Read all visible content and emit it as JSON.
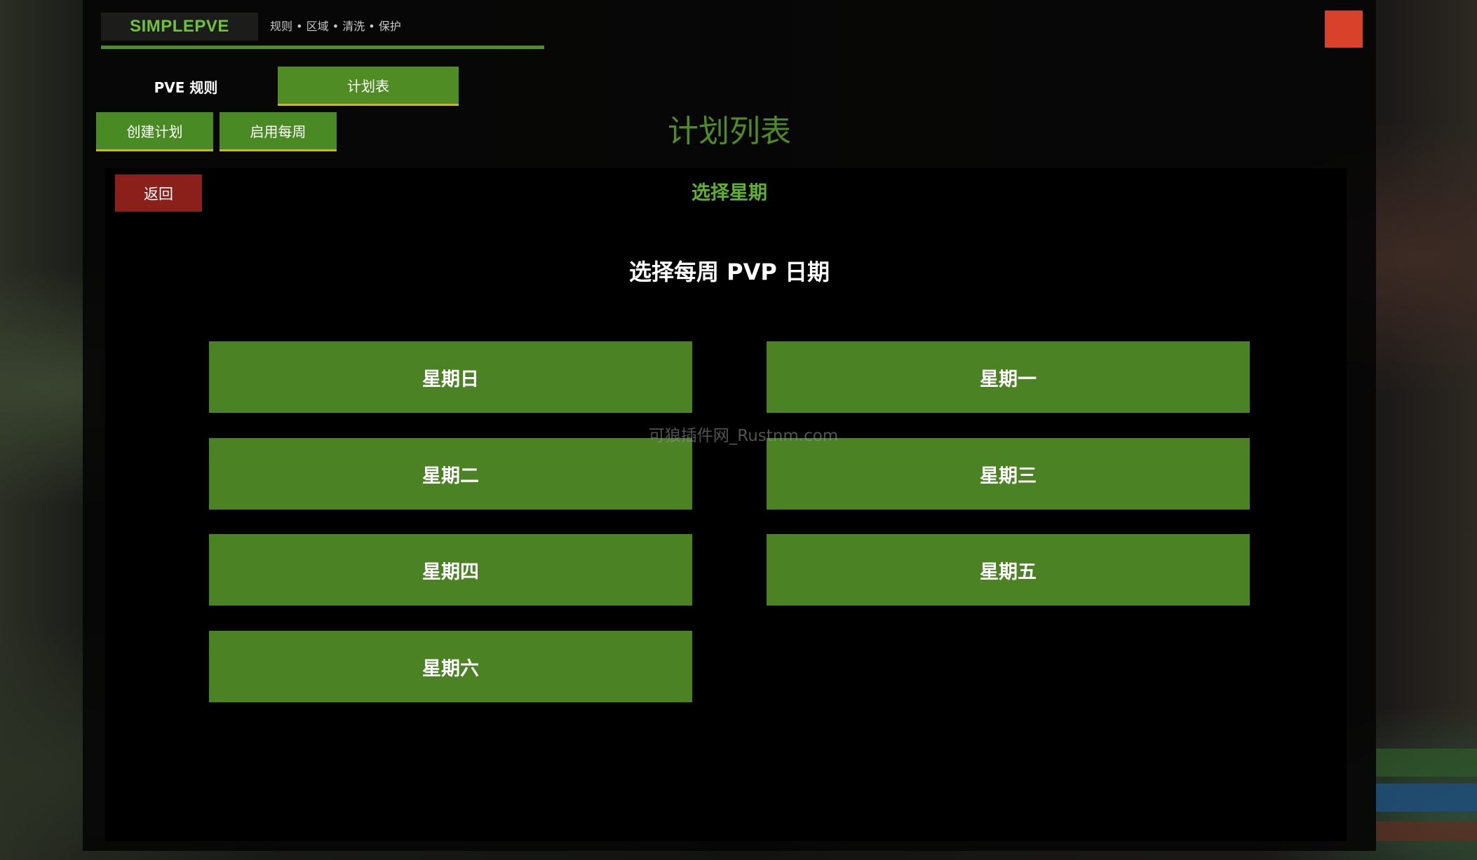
{
  "app": {
    "brand": "SIMPLEPVE",
    "subtitle": "规则 • 区域 • 清洗 • 保护"
  },
  "tabs": [
    {
      "label": "PVE 规则",
      "active": false
    },
    {
      "label": "计划表",
      "active": true
    }
  ],
  "toolbar": {
    "create_plan": "创建计划",
    "enable_weekly": "启用每周"
  },
  "main": {
    "title": "计划列表",
    "back_label": "返回",
    "section_title": "选择星期",
    "heading": "选择每周 PVP 日期"
  },
  "days": [
    {
      "label": "星期日"
    },
    {
      "label": "星期一"
    },
    {
      "label": "星期二"
    },
    {
      "label": "星期三"
    },
    {
      "label": "星期四"
    },
    {
      "label": "星期五"
    },
    {
      "label": "星期六"
    }
  ],
  "watermark": "可狼插件网_Rustnm.com",
  "colors": {
    "accent_green": "#4b8224",
    "title_green": "#4f8d24",
    "brand_green": "#6fc23a",
    "back_red": "#8b1f1a",
    "close_red": "#d9412a",
    "underline_gold": "#c9b43a"
  },
  "icons": {
    "close": "close-icon"
  }
}
